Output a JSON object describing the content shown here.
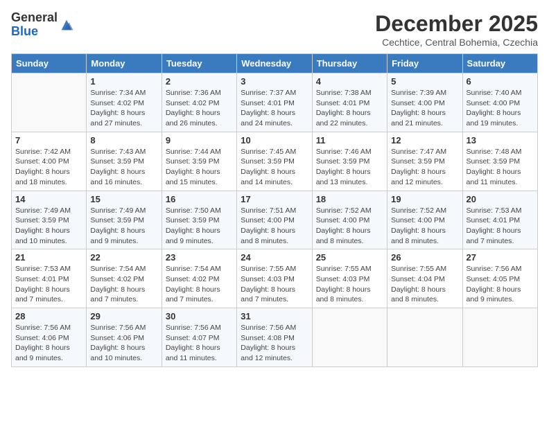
{
  "header": {
    "logo_general": "General",
    "logo_blue": "Blue",
    "title": "December 2025",
    "location": "Cechtice, Central Bohemia, Czechia"
  },
  "weekdays": [
    "Sunday",
    "Monday",
    "Tuesday",
    "Wednesday",
    "Thursday",
    "Friday",
    "Saturday"
  ],
  "weeks": [
    [
      {
        "day": "",
        "sunrise": "",
        "sunset": "",
        "daylight": ""
      },
      {
        "day": "1",
        "sunrise": "Sunrise: 7:34 AM",
        "sunset": "Sunset: 4:02 PM",
        "daylight": "Daylight: 8 hours and 27 minutes."
      },
      {
        "day": "2",
        "sunrise": "Sunrise: 7:36 AM",
        "sunset": "Sunset: 4:02 PM",
        "daylight": "Daylight: 8 hours and 26 minutes."
      },
      {
        "day": "3",
        "sunrise": "Sunrise: 7:37 AM",
        "sunset": "Sunset: 4:01 PM",
        "daylight": "Daylight: 8 hours and 24 minutes."
      },
      {
        "day": "4",
        "sunrise": "Sunrise: 7:38 AM",
        "sunset": "Sunset: 4:01 PM",
        "daylight": "Daylight: 8 hours and 22 minutes."
      },
      {
        "day": "5",
        "sunrise": "Sunrise: 7:39 AM",
        "sunset": "Sunset: 4:00 PM",
        "daylight": "Daylight: 8 hours and 21 minutes."
      },
      {
        "day": "6",
        "sunrise": "Sunrise: 7:40 AM",
        "sunset": "Sunset: 4:00 PM",
        "daylight": "Daylight: 8 hours and 19 minutes."
      }
    ],
    [
      {
        "day": "7",
        "sunrise": "Sunrise: 7:42 AM",
        "sunset": "Sunset: 4:00 PM",
        "daylight": "Daylight: 8 hours and 18 minutes."
      },
      {
        "day": "8",
        "sunrise": "Sunrise: 7:43 AM",
        "sunset": "Sunset: 3:59 PM",
        "daylight": "Daylight: 8 hours and 16 minutes."
      },
      {
        "day": "9",
        "sunrise": "Sunrise: 7:44 AM",
        "sunset": "Sunset: 3:59 PM",
        "daylight": "Daylight: 8 hours and 15 minutes."
      },
      {
        "day": "10",
        "sunrise": "Sunrise: 7:45 AM",
        "sunset": "Sunset: 3:59 PM",
        "daylight": "Daylight: 8 hours and 14 minutes."
      },
      {
        "day": "11",
        "sunrise": "Sunrise: 7:46 AM",
        "sunset": "Sunset: 3:59 PM",
        "daylight": "Daylight: 8 hours and 13 minutes."
      },
      {
        "day": "12",
        "sunrise": "Sunrise: 7:47 AM",
        "sunset": "Sunset: 3:59 PM",
        "daylight": "Daylight: 8 hours and 12 minutes."
      },
      {
        "day": "13",
        "sunrise": "Sunrise: 7:48 AM",
        "sunset": "Sunset: 3:59 PM",
        "daylight": "Daylight: 8 hours and 11 minutes."
      }
    ],
    [
      {
        "day": "14",
        "sunrise": "Sunrise: 7:49 AM",
        "sunset": "Sunset: 3:59 PM",
        "daylight": "Daylight: 8 hours and 10 minutes."
      },
      {
        "day": "15",
        "sunrise": "Sunrise: 7:49 AM",
        "sunset": "Sunset: 3:59 PM",
        "daylight": "Daylight: 8 hours and 9 minutes."
      },
      {
        "day": "16",
        "sunrise": "Sunrise: 7:50 AM",
        "sunset": "Sunset: 3:59 PM",
        "daylight": "Daylight: 8 hours and 9 minutes."
      },
      {
        "day": "17",
        "sunrise": "Sunrise: 7:51 AM",
        "sunset": "Sunset: 4:00 PM",
        "daylight": "Daylight: 8 hours and 8 minutes."
      },
      {
        "day": "18",
        "sunrise": "Sunrise: 7:52 AM",
        "sunset": "Sunset: 4:00 PM",
        "daylight": "Daylight: 8 hours and 8 minutes."
      },
      {
        "day": "19",
        "sunrise": "Sunrise: 7:52 AM",
        "sunset": "Sunset: 4:00 PM",
        "daylight": "Daylight: 8 hours and 8 minutes."
      },
      {
        "day": "20",
        "sunrise": "Sunrise: 7:53 AM",
        "sunset": "Sunset: 4:01 PM",
        "daylight": "Daylight: 8 hours and 7 minutes."
      }
    ],
    [
      {
        "day": "21",
        "sunrise": "Sunrise: 7:53 AM",
        "sunset": "Sunset: 4:01 PM",
        "daylight": "Daylight: 8 hours and 7 minutes."
      },
      {
        "day": "22",
        "sunrise": "Sunrise: 7:54 AM",
        "sunset": "Sunset: 4:02 PM",
        "daylight": "Daylight: 8 hours and 7 minutes."
      },
      {
        "day": "23",
        "sunrise": "Sunrise: 7:54 AM",
        "sunset": "Sunset: 4:02 PM",
        "daylight": "Daylight: 8 hours and 7 minutes."
      },
      {
        "day": "24",
        "sunrise": "Sunrise: 7:55 AM",
        "sunset": "Sunset: 4:03 PM",
        "daylight": "Daylight: 8 hours and 7 minutes."
      },
      {
        "day": "25",
        "sunrise": "Sunrise: 7:55 AM",
        "sunset": "Sunset: 4:03 PM",
        "daylight": "Daylight: 8 hours and 8 minutes."
      },
      {
        "day": "26",
        "sunrise": "Sunrise: 7:55 AM",
        "sunset": "Sunset: 4:04 PM",
        "daylight": "Daylight: 8 hours and 8 minutes."
      },
      {
        "day": "27",
        "sunrise": "Sunrise: 7:56 AM",
        "sunset": "Sunset: 4:05 PM",
        "daylight": "Daylight: 8 hours and 9 minutes."
      }
    ],
    [
      {
        "day": "28",
        "sunrise": "Sunrise: 7:56 AM",
        "sunset": "Sunset: 4:06 PM",
        "daylight": "Daylight: 8 hours and 9 minutes."
      },
      {
        "day": "29",
        "sunrise": "Sunrise: 7:56 AM",
        "sunset": "Sunset: 4:06 PM",
        "daylight": "Daylight: 8 hours and 10 minutes."
      },
      {
        "day": "30",
        "sunrise": "Sunrise: 7:56 AM",
        "sunset": "Sunset: 4:07 PM",
        "daylight": "Daylight: 8 hours and 11 minutes."
      },
      {
        "day": "31",
        "sunrise": "Sunrise: 7:56 AM",
        "sunset": "Sunset: 4:08 PM",
        "daylight": "Daylight: 8 hours and 12 minutes."
      },
      {
        "day": "",
        "sunrise": "",
        "sunset": "",
        "daylight": ""
      },
      {
        "day": "",
        "sunrise": "",
        "sunset": "",
        "daylight": ""
      },
      {
        "day": "",
        "sunrise": "",
        "sunset": "",
        "daylight": ""
      }
    ]
  ]
}
